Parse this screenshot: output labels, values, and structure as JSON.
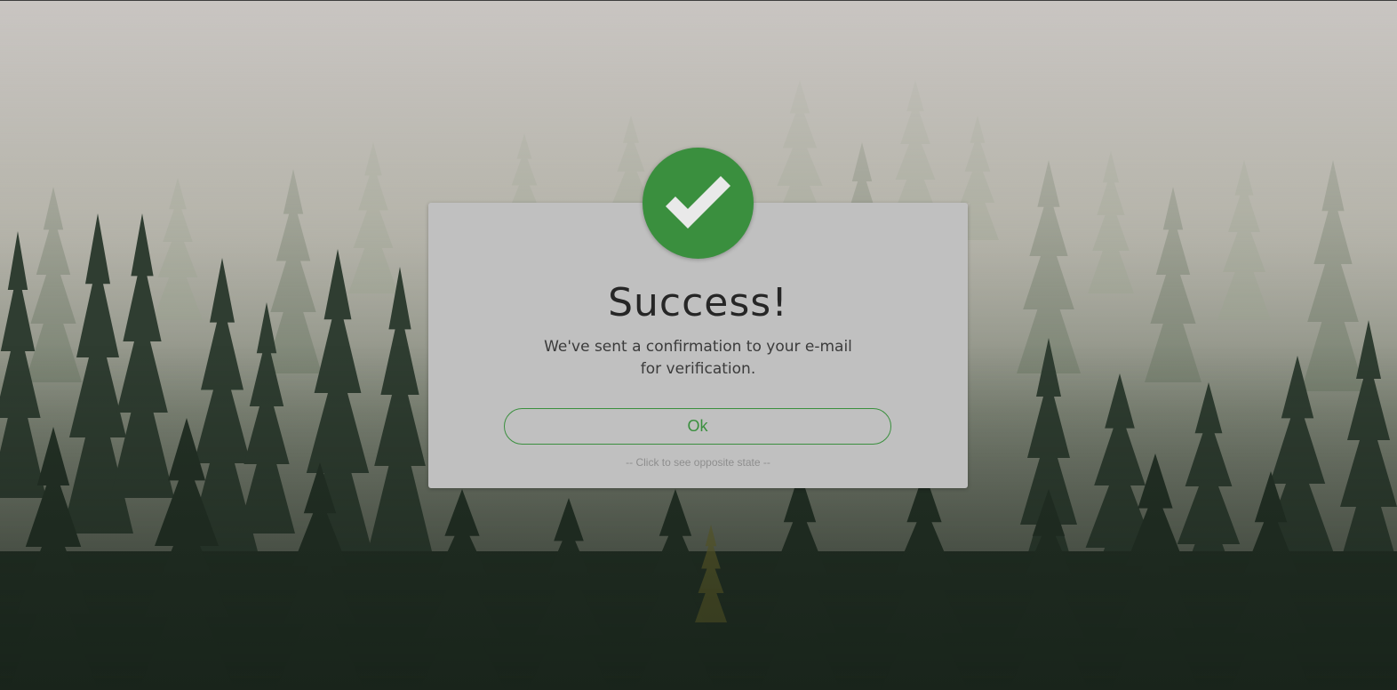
{
  "background": {
    "description_icon": "foggy-forest-background",
    "fog_color": "#c6c2bf",
    "forest_color": "#27352b"
  },
  "dialog": {
    "status_icon": "checkmark-icon",
    "accent_color": "#3a8f3e",
    "title": "Success!",
    "message_line_1": "We've sent a confirmation to your e-mail",
    "message_line_2": "for verification.",
    "ok_button_label": "Ok",
    "toggle_link_label": "-- Click to see opposite state --"
  }
}
